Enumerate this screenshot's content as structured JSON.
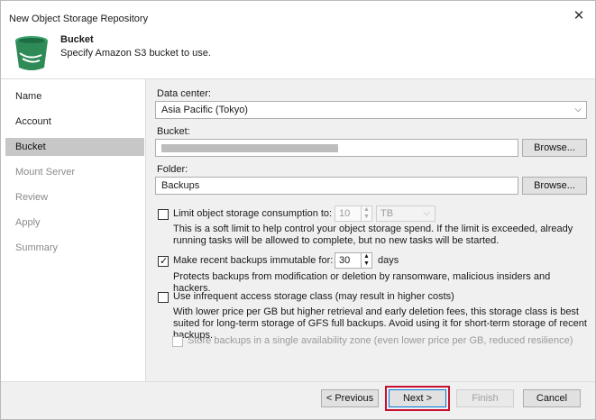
{
  "window": {
    "title": "New Object Storage Repository",
    "close_glyph": "✕"
  },
  "header": {
    "title": "Bucket",
    "subtitle": "Specify Amazon S3 bucket to use.",
    "icon": "bucket-icon"
  },
  "sidebar": {
    "items": [
      {
        "label": "Name",
        "state": "normal"
      },
      {
        "label": "Account",
        "state": "normal"
      },
      {
        "label": "Bucket",
        "state": "active"
      },
      {
        "label": "Mount Server",
        "state": "inactive"
      },
      {
        "label": "Review",
        "state": "inactive"
      },
      {
        "label": "Apply",
        "state": "inactive"
      },
      {
        "label": "Summary",
        "state": "inactive"
      }
    ]
  },
  "form": {
    "datacenter": {
      "label": "Data center:",
      "value": "Asia Pacific (Tokyo)"
    },
    "bucket": {
      "label": "Bucket:",
      "value": "",
      "browse_label": "Browse..."
    },
    "folder": {
      "label": "Folder:",
      "value": "Backups",
      "browse_label": "Browse..."
    },
    "limit": {
      "checked": false,
      "label": "Limit object storage consumption to:",
      "value": "10",
      "unit": "TB",
      "description": "This is a soft limit to help control your object storage spend. If the limit is exceeded, already running tasks will be allowed to complete, but no new tasks will be started."
    },
    "immutable": {
      "checked": true,
      "label": "Make recent backups immutable for:",
      "value": "30",
      "unit": "days",
      "description": "Protects backups from modification or deletion by ransomware, malicious insiders and hackers."
    },
    "infrequent": {
      "checked": false,
      "label": "Use infrequent access storage class (may result in higher costs)",
      "description": "With lower price per GB but higher retrieval and early deletion fees, this storage class is best suited for long-term storage of GFS full backups. Avoid using it for short-term storage of recent backups."
    },
    "single_zone": {
      "checked": false,
      "enabled": false,
      "label": "Store backups in a single availability zone (even lower price per GB, reduced resilience)"
    }
  },
  "footer": {
    "previous_label": "< Previous",
    "next_label": "Next >",
    "finish_label": "Finish",
    "cancel_label": "Cancel"
  },
  "colors": {
    "accent_highlight": "#c8102e",
    "selected_nav": "#c7c7c7",
    "bucket_green": "#2e8b57"
  }
}
